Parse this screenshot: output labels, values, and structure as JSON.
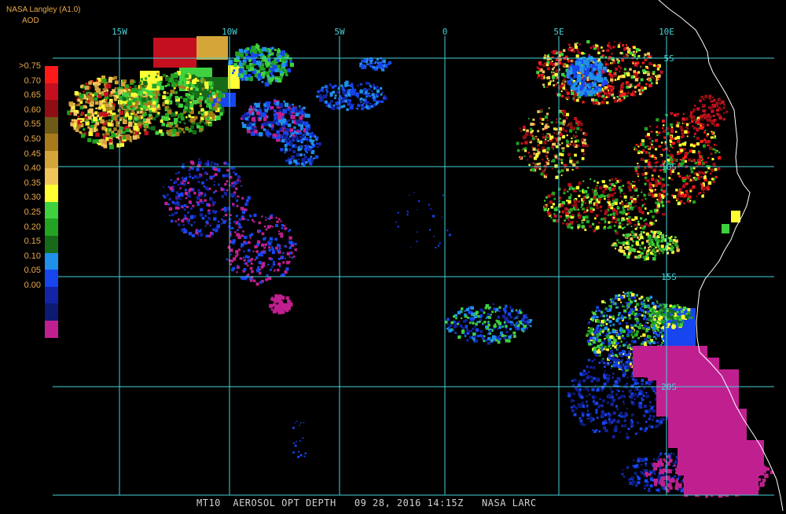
{
  "header": {
    "source": "NASA Langley (A1.0)",
    "variable": "AOD"
  },
  "legend": {
    "labels": [
      ">0.75",
      "0.70",
      "0.65",
      "0.60",
      "0.55",
      "0.50",
      "0.45",
      "0.40",
      "0.35",
      "0.30",
      "0.25",
      "0.20",
      "0.15",
      "0.10",
      "0.05",
      "0.00"
    ],
    "colors": [
      "#ff1a1a",
      "#c4101e",
      "#8f0e14",
      "#6e5a16",
      "#a87a1c",
      "#d4a63a",
      "#f2c55a",
      "#ffff33",
      "#3fd13f",
      "#22a322",
      "#176a17",
      "#2090ea",
      "#1745ee",
      "#1424a6",
      "#0c1a72",
      "#c0208f"
    ]
  },
  "map": {
    "lon_labels": [
      "15W",
      "10W",
      "5W",
      "0",
      "5E",
      "10E"
    ],
    "lat_labels": [
      "5S",
      "10S",
      "15S",
      "20S"
    ],
    "grid_color": "#46d2d8",
    "coast_color": "#ffffff"
  },
  "footer": {
    "text": "MT10  AEROSOL OPT DEPTH   09 28, 2016 14:15Z   NASA LARC"
  }
}
